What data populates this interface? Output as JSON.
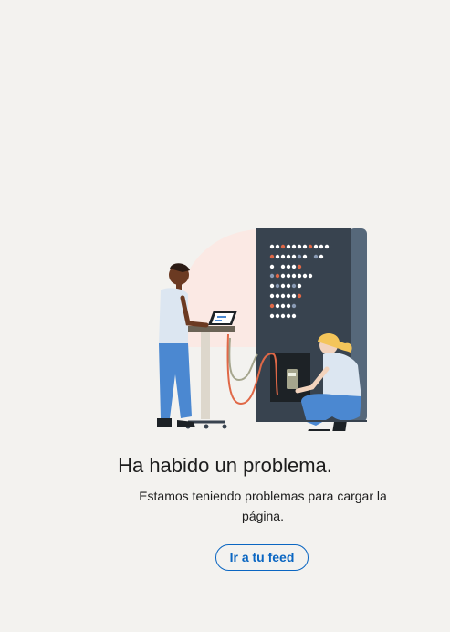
{
  "error": {
    "title": "Ha habido un problema.",
    "message": "Estamos teniendo problemas para cargar la página.",
    "button_label": "Ir a tu feed"
  },
  "illustration": {
    "icon": "server-room-technicians-illustration"
  },
  "colors": {
    "background": "#f3f2ef",
    "accent": "#0a66c2",
    "server_dark": "#38434f",
    "server_side": "#56687a",
    "shirt": "#dce6f1",
    "pants": "#4b88d1",
    "cable_orange": "#e06847",
    "cable_gray": "#a5a58d",
    "blush_circle": "#fbe9e4"
  }
}
